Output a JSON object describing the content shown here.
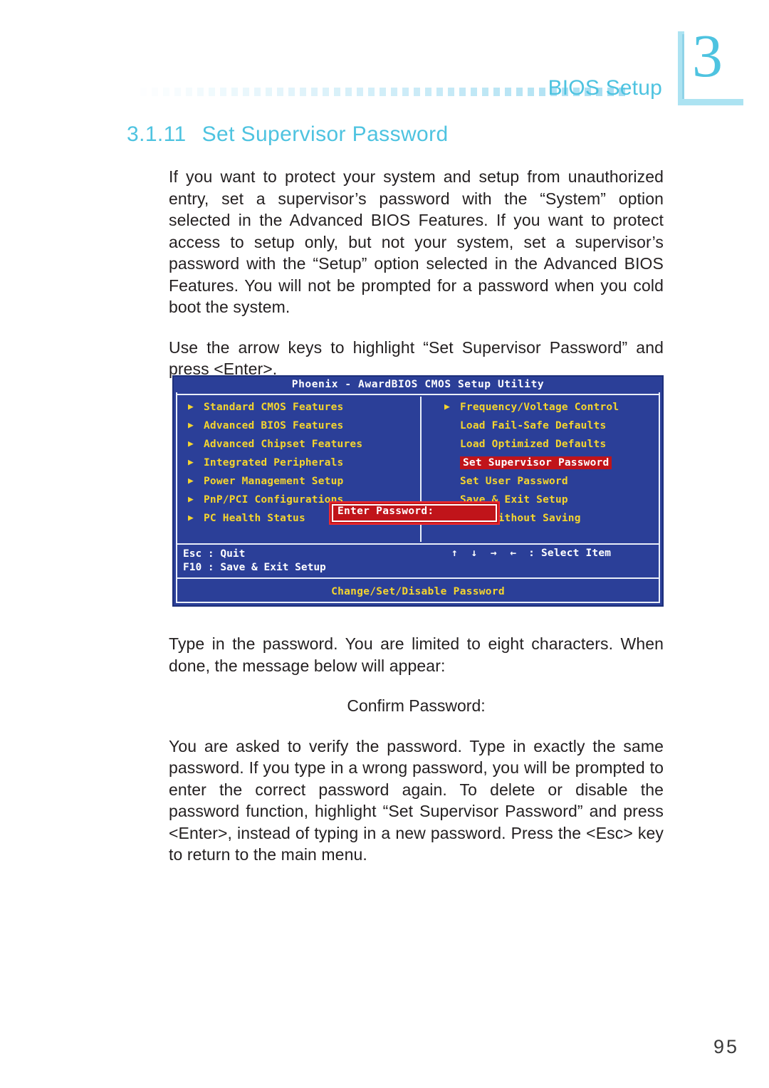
{
  "header": {
    "chapter_number": "3",
    "title": "BIOS Setup",
    "rule_square_count": 44,
    "accent_color": "#4ec3e0",
    "rule_color": "#cfe9f8"
  },
  "section": {
    "number": "3.1.11",
    "title": "Set Supervisor Password"
  },
  "paragraphs": {
    "p1": "If you want to protect your system and setup from unauthorized entry, set a supervisor’s password with the “System” option selected in the Advanced BIOS Features. If you want to protect access to setup only, but not your system, set a supervisor’s password with the “Setup” option selected in the Advanced BIOS Features. You will not be prompted for a password when you cold boot the system.",
    "p2": "Use the arrow keys to highlight “Set Supervisor Password” and press <Enter>.",
    "p3": "Type in the password. You are limited to eight characters. When done, the message below will appear:",
    "confirm_note": "Confirm Password:",
    "p4": "You are asked to verify the password. Type in exactly the same password. If you type in a wrong password, you will be prompted to enter the correct password again. To delete or disable the password function, highlight “Set Supervisor Password” and press <Enter>, instead of typing in a new password. Press the <Esc> key to return to the main menu."
  },
  "bios": {
    "title": "Phoenix - AwardBIOS CMOS Setup Utility",
    "left_items": [
      {
        "label": "Standard CMOS Features",
        "arrow": true
      },
      {
        "label": "Advanced BIOS Features",
        "arrow": true
      },
      {
        "label": "Advanced Chipset Features",
        "arrow": true
      },
      {
        "label": "Integrated Peripherals",
        "arrow": true
      },
      {
        "label": "Power Management Setup",
        "arrow": true
      },
      {
        "label": "PnP/PCI Configurations",
        "arrow": true
      },
      {
        "label": "PC Health Status",
        "arrow": true
      }
    ],
    "right_items": [
      {
        "label": "Frequency/Voltage Control",
        "arrow": true,
        "highlight": false
      },
      {
        "label": "Load Fail-Safe Defaults",
        "arrow": false,
        "highlight": false
      },
      {
        "label": "Load Optimized Defaults",
        "arrow": false,
        "highlight": false
      },
      {
        "label": "Set Supervisor Password",
        "arrow": false,
        "highlight": true
      },
      {
        "label": "Set User Password",
        "arrow": false,
        "highlight": false
      },
      {
        "label": "Save & Exit Setup",
        "arrow": false,
        "highlight": false
      },
      {
        "label": "Exit Without Saving",
        "arrow": false,
        "highlight": false
      }
    ],
    "dialog": {
      "prompt": "Enter Password:"
    },
    "keys": {
      "esc": "Esc : Quit",
      "f10": "F10 : Save & Exit Setup",
      "arrows": "↑ ↓ → ←",
      "select": ": Select Item"
    },
    "footer": "Change/Set/Disable Password",
    "colors": {
      "background": "#2b3f98",
      "menu_text": "#f5d52e",
      "key_text": "#ffffff",
      "highlight_bg": "#c0141a",
      "dialog_border": "#ef2a2f"
    }
  },
  "footer": {
    "page_number": "95"
  }
}
